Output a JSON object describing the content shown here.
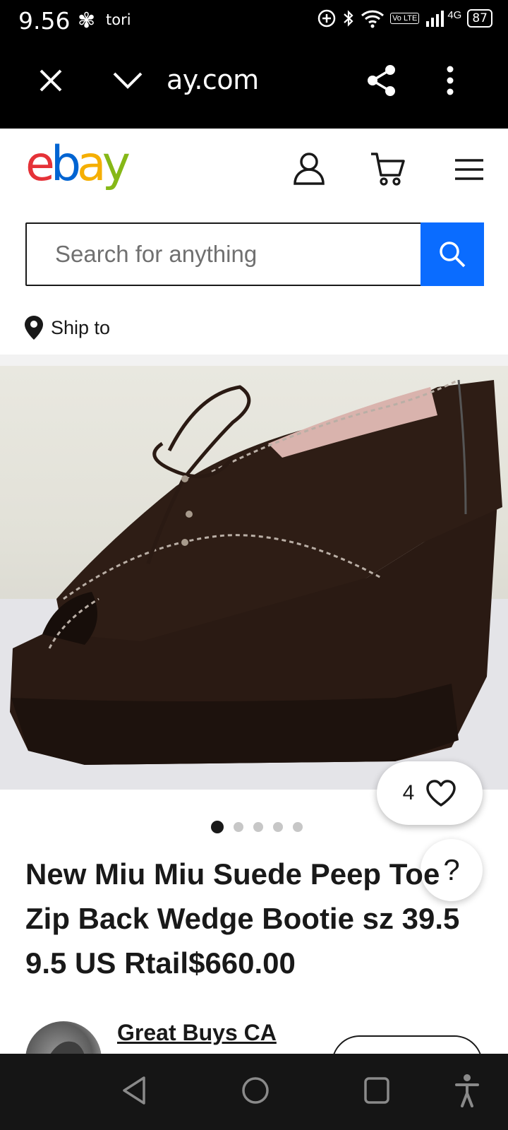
{
  "status_bar": {
    "time": "9.56",
    "notification_app": "tori",
    "network": "4G",
    "volte": "Vo LTE",
    "battery": "87"
  },
  "browser": {
    "url": "ay.com"
  },
  "header": {
    "logo_letters": [
      "e",
      "b",
      "a",
      "y"
    ],
    "logo_colors": [
      "#e53238",
      "#0064d2",
      "#f5af02",
      "#86b817"
    ]
  },
  "search": {
    "placeholder": "Search for anything",
    "button_color": "#0a6cff"
  },
  "ship_to": {
    "label": "Ship to"
  },
  "gallery": {
    "image_count": 5,
    "active_index": 0,
    "watch_count": "4"
  },
  "help": {
    "label": "?"
  },
  "product": {
    "title": "New Miu Miu Suede Peep Toe Zip Back Wedge Bootie sz 39.5 9.5 US Rtail$660.00"
  },
  "seller": {
    "name": "Great Buys CA"
  }
}
